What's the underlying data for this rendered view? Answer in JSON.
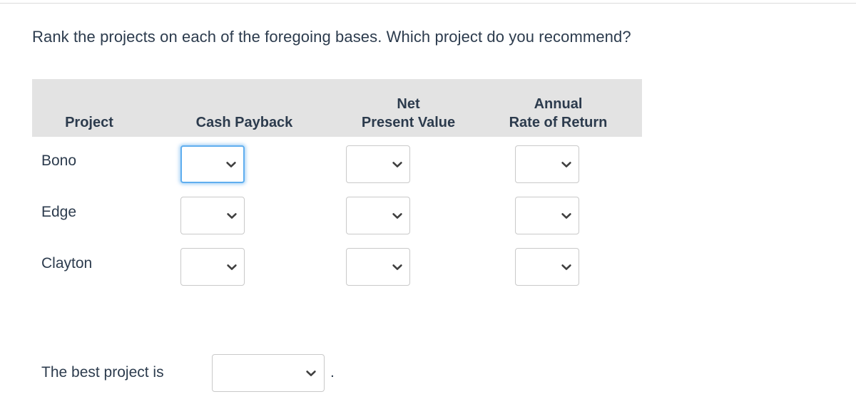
{
  "theme": {
    "page_background": "#ffffff",
    "text_color": "#2c3b4d",
    "header_band_color": "#e3e3e3",
    "field_border_color": "#c9c9c9",
    "focus_border_color": "#5faeef",
    "top_rule_color": "#dcdcdc"
  },
  "question": {
    "prompt": "Rank the projects on each of the foregoing bases. Which project do you recommend?"
  },
  "table": {
    "headers": [
      {
        "id": "project",
        "line1": "",
        "line2": "Project"
      },
      {
        "id": "cash-payback",
        "line1": "",
        "line2": "Cash Payback"
      },
      {
        "id": "net-present-value",
        "line1": "Net",
        "line2": "Present Value"
      },
      {
        "id": "annual-rate-of-return",
        "line1": "Annual",
        "line2": "Rate of Return"
      }
    ],
    "rows": [
      {
        "project": "Bono",
        "cells": [
          {
            "column": "cash-payback",
            "value": "",
            "focused": true
          },
          {
            "column": "net-present-value",
            "value": "",
            "focused": false
          },
          {
            "column": "annual-rate-of-return",
            "value": "",
            "focused": false
          }
        ]
      },
      {
        "project": "Edge",
        "cells": [
          {
            "column": "cash-payback",
            "value": "",
            "focused": false
          },
          {
            "column": "net-present-value",
            "value": "",
            "focused": false
          },
          {
            "column": "annual-rate-of-return",
            "value": "",
            "focused": false
          }
        ]
      },
      {
        "project": "Clayton",
        "cells": [
          {
            "column": "cash-payback",
            "value": "",
            "focused": false
          },
          {
            "column": "net-present-value",
            "value": "",
            "focused": false
          },
          {
            "column": "annual-rate-of-return",
            "value": "",
            "focused": false
          }
        ]
      }
    ]
  },
  "best_project": {
    "label": "The best project is",
    "value": "",
    "trailing_punctuation": "."
  },
  "icons": {
    "chevron_down": "chevron-down-icon"
  }
}
